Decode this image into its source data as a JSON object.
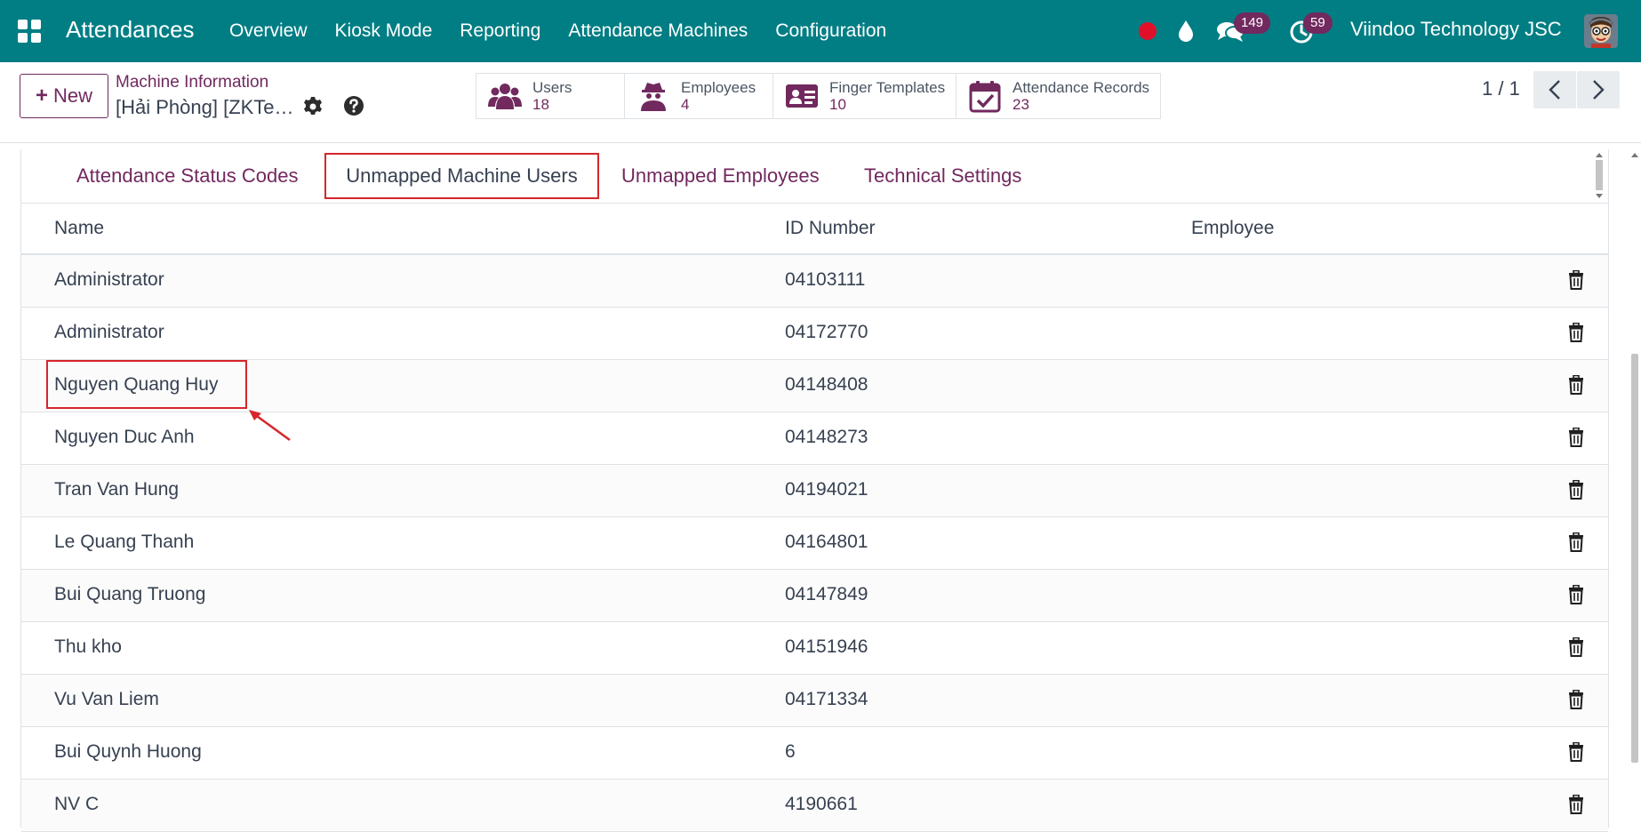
{
  "navbar": {
    "app_title": "Attendances",
    "menu": [
      "Overview",
      "Kiosk Mode",
      "Reporting",
      "Attendance Machines",
      "Configuration"
    ],
    "messages_badge": "149",
    "activities_badge": "59",
    "company": "Viindoo Technology JSC",
    "icons": [
      "apps-grid-icon",
      "recording-dot-icon",
      "droplet-icon",
      "chat-icon",
      "clock-icon"
    ],
    "colors": {
      "bar": "#017e84",
      "badge": "#71295e",
      "record": "#e0102a"
    }
  },
  "control": {
    "new_label": "New",
    "breadcrumb_parent": "Machine Information",
    "record_name": "[Hải Phòng] [ZKTe…",
    "pager": "1 / 1",
    "smart_buttons": [
      {
        "label": "Users",
        "value": "18",
        "icon": "users-icon"
      },
      {
        "label": "Employees",
        "value": "4",
        "icon": "spy-icon"
      },
      {
        "label": "Finger Templates",
        "value": "10",
        "icon": "id-card-icon"
      },
      {
        "label": "Attendance Records",
        "value": "23",
        "icon": "calendar-check-icon"
      }
    ]
  },
  "tabs": {
    "items": [
      "Attendance Status Codes",
      "Unmapped Machine Users",
      "Unmapped Employees",
      "Technical Settings"
    ],
    "active_index": 1
  },
  "table": {
    "headers": {
      "name": "Name",
      "id_number": "ID Number",
      "employee": "Employee"
    },
    "rows": [
      {
        "name": "Administrator",
        "id_number": "04103111",
        "employee": ""
      },
      {
        "name": "Administrator",
        "id_number": "04172770",
        "employee": ""
      },
      {
        "name": "Nguyen Quang Huy",
        "id_number": "04148408",
        "employee": ""
      },
      {
        "name": "Nguyen Duc Anh",
        "id_number": "04148273",
        "employee": ""
      },
      {
        "name": "Tran Van Hung",
        "id_number": "04194021",
        "employee": ""
      },
      {
        "name": "Le Quang Thanh",
        "id_number": "04164801",
        "employee": ""
      },
      {
        "name": "Bui Quang Truong",
        "id_number": "04147849",
        "employee": ""
      },
      {
        "name": "Thu kho",
        "id_number": "04151946",
        "employee": ""
      },
      {
        "name": "Vu Van Liem",
        "id_number": "04171334",
        "employee": ""
      },
      {
        "name": "Bui Quynh Huong",
        "id_number": "6",
        "employee": ""
      },
      {
        "name": "NV C",
        "id_number": "4190661",
        "employee": ""
      }
    ]
  },
  "annotation": {
    "highlight_color": "#d6262b",
    "highlighted_row": "Nguyen Quang Huy"
  }
}
